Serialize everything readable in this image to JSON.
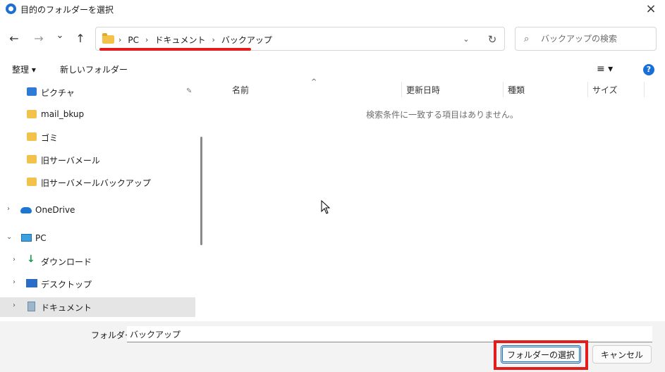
{
  "window": {
    "title": "目的のフォルダーを選択",
    "close_icon": "×"
  },
  "nav": {
    "back_icon": "←",
    "forward_icon": "→",
    "recent_icon": "⌄",
    "up_icon": "↑",
    "breadcrumbs": [
      "PC",
      "ドキュメント",
      "バックアップ"
    ],
    "separator": "›",
    "dropdown_icon": "⌄",
    "refresh_icon": "↻"
  },
  "search": {
    "placeholder": "バックアップの検索",
    "icon": "⌕"
  },
  "toolbar": {
    "organize_label": "整理 ▾",
    "new_folder_label": "新しいフォルダー",
    "view_icon": "≡ ▾",
    "help_label": "?"
  },
  "sidebar": {
    "quick_items": [
      {
        "label": "ピクチャ",
        "icon": "pictures"
      },
      {
        "label": "mail_bkup",
        "icon": "folder"
      },
      {
        "label": "ゴミ",
        "icon": "folder"
      },
      {
        "label": "旧サーバメール",
        "icon": "folder"
      },
      {
        "label": "旧サーバメールバックアップ",
        "icon": "folder"
      }
    ],
    "onedrive_label": "OneDrive",
    "pc_label": "PC",
    "pc_children": [
      {
        "label": "ダウンロード",
        "icon": "download"
      },
      {
        "label": "デスクトップ",
        "icon": "desktop"
      },
      {
        "label": "ドキュメント",
        "icon": "documents"
      }
    ],
    "expand_icon": "›",
    "collapse_icon": "⌄",
    "pin_icon": "📌"
  },
  "file_list": {
    "columns": [
      "名前",
      "更新日時",
      "種類",
      "サイズ"
    ],
    "sort_icon": "^",
    "empty_message": "検索条件に一致する項目はありません。"
  },
  "footer": {
    "folder_label": "フォルダー:",
    "folder_value": "バックアップ",
    "select_button": "フォルダーの選択",
    "cancel_button": "キャンセル"
  },
  "colors": {
    "accent": "#1a6fd6",
    "highlight": "#e31c1c",
    "selection": "#e5e5e5"
  }
}
